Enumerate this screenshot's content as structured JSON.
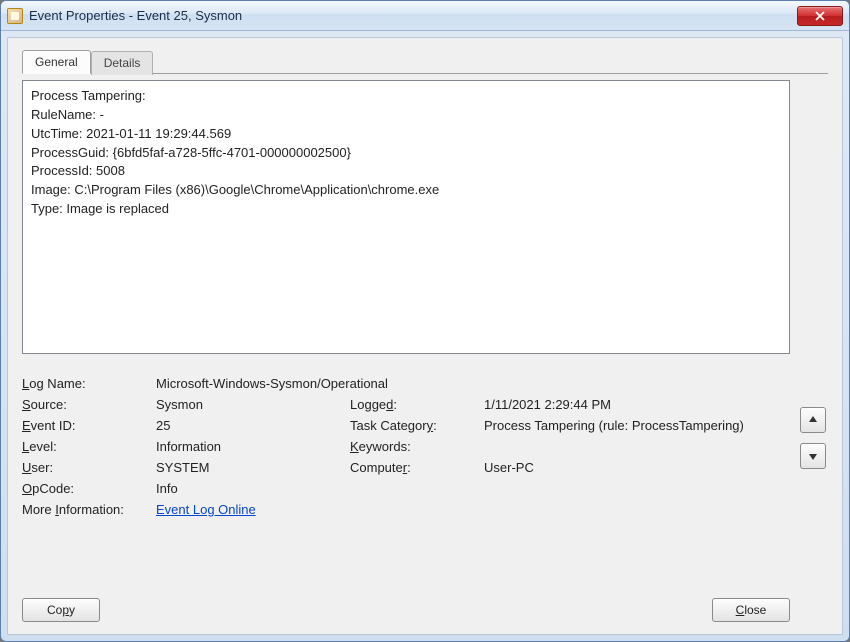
{
  "window": {
    "title": "Event Properties - Event 25, Sysmon"
  },
  "tabs": {
    "general": "General",
    "details": "Details"
  },
  "description": "Process Tampering:\nRuleName: -\nUtcTime: 2021-01-11 19:29:44.569\nProcessGuid: {6bfd5faf-a728-5ffc-4701-000000002500}\nProcessId: 5008\nImage: C:\\Program Files (x86)\\Google\\Chrome\\Application\\chrome.exe\nType: Image is replaced",
  "fields": {
    "log_name_label": "Log Name:",
    "log_name": "Microsoft-Windows-Sysmon/Operational",
    "source_label": "Source:",
    "source": "Sysmon",
    "logged_label": "Logged:",
    "logged": "1/11/2021 2:29:44 PM",
    "event_id_label": "Event ID:",
    "event_id": "25",
    "task_category_label": "Task Category:",
    "task_category": "Process Tampering (rule: ProcessTampering)",
    "level_label": "Level:",
    "level": "Information",
    "keywords_label": "Keywords:",
    "keywords": "",
    "user_label": "User:",
    "user": "SYSTEM",
    "computer_label": "Computer:",
    "computer": "User-PC",
    "opcode_label": "OpCode:",
    "opcode": "Info",
    "more_info_label": "More Information:",
    "more_info_link": "Event Log Online "
  },
  "buttons": {
    "copy": "Copy",
    "close": "Close"
  }
}
